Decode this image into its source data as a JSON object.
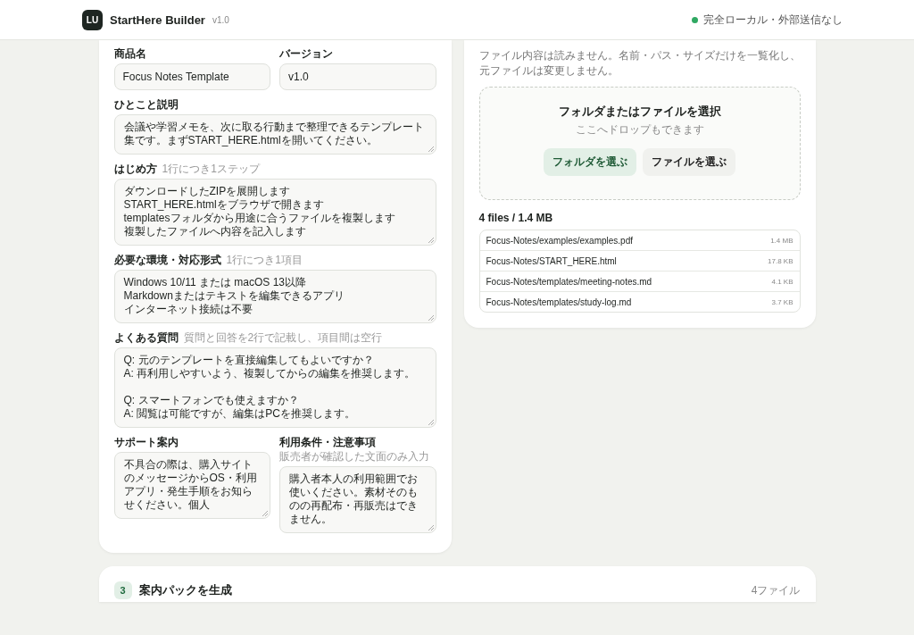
{
  "header": {
    "logo": "LU",
    "title": "StartHere Builder",
    "version": "v1.0",
    "status": "完全ローカル・外部送信なし"
  },
  "form": {
    "rows": [
      {
        "fields": [
          {
            "kind": "input",
            "label": "商品名",
            "value": "Focus Notes Template"
          },
          {
            "kind": "input",
            "label": "バージョン",
            "value": "v1.0"
          }
        ]
      },
      {
        "fields": [
          {
            "kind": "textarea",
            "label": "ひとこと説明",
            "paragraphs": [
              [
                "会議や学習メモを、次に取る行動まで整理できるテンプレート集です。まずSTART_HERE.htmlを開いてください。"
              ]
            ]
          }
        ]
      },
      {
        "fields": [
          {
            "kind": "textarea",
            "label": "はじめ方",
            "hint": "1行につき1ステップ",
            "paragraphs": [
              [
                "ダウンロードしたZIPを展開します",
                "START_HERE.htmlをブラウザで開きます",
                "templatesフォルダから用途に合うファイルを複製します",
                "複製したファイルへ内容を記入します"
              ]
            ]
          }
        ]
      },
      {
        "fields": [
          {
            "kind": "textarea",
            "label": "必要な環境・対応形式",
            "hint": "1行につき1項目",
            "paragraphs": [
              [
                "Windows 10/11 または macOS 13以降",
                "Markdownまたはテキストを編集できるアプリ",
                "インターネット接続は不要"
              ]
            ]
          }
        ]
      },
      {
        "fields": [
          {
            "kind": "textarea",
            "label": "よくある質問",
            "hint": "質問と回答を2行で記載し、項目間は空行",
            "paragraphs": [
              [
                "Q: 元のテンプレートを直接編集してもよいですか？",
                "A: 再利用しやすいよう、複製してからの編集を推奨します。"
              ],
              [
                "Q: スマートフォンでも使えますか？",
                "A: 閲覧は可能ですが、編集はPCを推奨します。"
              ]
            ]
          }
        ]
      },
      {
        "fields": [
          {
            "kind": "textarea",
            "label": "サポート案内",
            "paragraphs": [
              [
                "不具合の際は、購入サイトのメッセージからOS・利用アプリ・発生手順をお知らせください。個人"
              ]
            ]
          },
          {
            "kind": "textarea",
            "label": "利用条件・注意事項",
            "hint": "販売者が確認した文面のみ入力",
            "paragraphs": [
              [
                "購入者本人の利用範囲でお使いください。素材そのものの再配布・再販売はできません。"
              ]
            ]
          }
        ]
      }
    ]
  },
  "files": {
    "note": "ファイル内容は読みません。名前・パス・サイズだけを一覧化し、元ファイルは変更しません。",
    "dropzone": {
      "title": "フォルダまたはファイルを選択",
      "hint": "ここへドロップもできます",
      "buttons": [
        {
          "kind": "primary",
          "label": "フォルダを選ぶ"
        },
        {
          "kind": "secondary",
          "label": "ファイルを選ぶ"
        }
      ]
    },
    "summary": "4 files / 1.4 MB",
    "list": [
      {
        "path": "Focus-Notes/examples/examples.pdf",
        "size": "1.4 MB"
      },
      {
        "path": "Focus-Notes/START_HERE.html",
        "size": "17.8 KB"
      },
      {
        "path": "Focus-Notes/templates/meeting-notes.md",
        "size": "4.1 KB"
      },
      {
        "path": "Focus-Notes/templates/study-log.md",
        "size": "3.7 KB"
      }
    ]
  },
  "generate": {
    "step": "3",
    "title": "案内パックを生成",
    "count": "4ファイル"
  }
}
